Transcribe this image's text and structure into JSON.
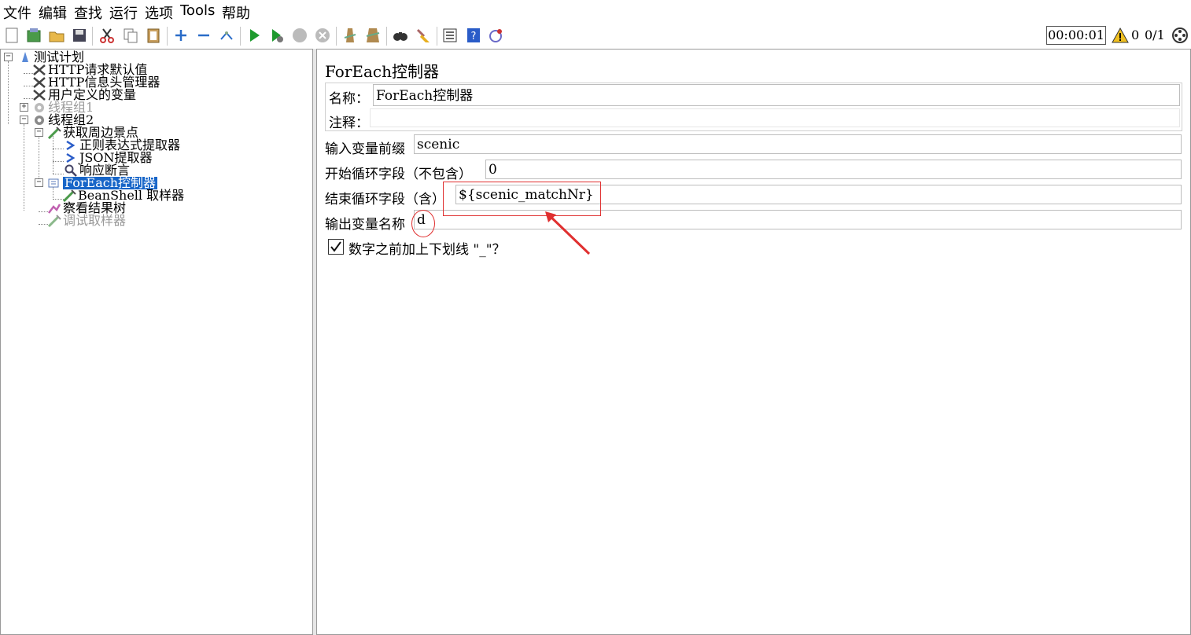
{
  "menu": [
    "文件",
    "编辑",
    "查找",
    "运行",
    "选项",
    "Tools",
    "帮助"
  ],
  "toolbar": {
    "icons": [
      "new-icon",
      "templates-icon",
      "open-icon",
      "save-icon",
      "cut-icon",
      "copy-icon",
      "paste-icon",
      "expand-icon",
      "collapse-icon",
      "toggle-icon",
      "start-icon",
      "start-no-pause-icon",
      "stop-icon",
      "shutdown-icon",
      "clear-icon",
      "clear-all-icon",
      "search-icon",
      "reset-search-icon",
      "function-helper-icon",
      "help-icon",
      "remote-icon"
    ],
    "timer": "00:00:01",
    "warnings": "0",
    "threads": "0/1"
  },
  "tree": [
    {
      "label": "测试计划",
      "icon": "test-plan-icon",
      "state": "normal"
    },
    {
      "label": "HTTP请求默认值",
      "icon": "config-wrench-icon",
      "state": "normal"
    },
    {
      "label": "HTTP信息头管理器",
      "icon": "config-wrench-icon",
      "state": "normal"
    },
    {
      "label": "用户定义的变量",
      "icon": "config-wrench-icon",
      "state": "normal"
    },
    {
      "label": "线程组1",
      "icon": "gear-icon",
      "state": "disabled"
    },
    {
      "label": "线程组2",
      "icon": "gear-icon",
      "state": "normal"
    },
    {
      "label": "获取周边景点",
      "icon": "sampler-pipette-icon",
      "state": "normal"
    },
    {
      "label": "正则表达式提取器",
      "icon": "extractor-arrow-icon",
      "state": "normal"
    },
    {
      "label": "JSON提取器",
      "icon": "extractor-arrow-icon",
      "state": "normal"
    },
    {
      "label": "响应断言",
      "icon": "magnifier-icon",
      "state": "normal"
    },
    {
      "label": "ForEach控制器",
      "icon": "foreach-controller-icon",
      "state": "selected"
    },
    {
      "label": "BeanShell 取样器",
      "icon": "sampler-pipette-icon",
      "state": "normal"
    },
    {
      "label": "察看结果树",
      "icon": "listener-icon",
      "state": "normal"
    },
    {
      "label": "调试取样器",
      "icon": "sampler-pipette-icon",
      "state": "disabled"
    }
  ],
  "panel": {
    "title": "ForEach控制器",
    "name_label": "名称：",
    "name_value": "ForEach控制器",
    "comment_label": "注释：",
    "comment_value": "",
    "prefix_label": "输入变量前缀",
    "prefix_value": "scenic",
    "start_label": "开始循环字段（不包含）",
    "start_value": "0",
    "end_label": "结束循环字段（含）",
    "end_value": "${scenic_matchNr}",
    "output_label": "输出变量名称",
    "output_value": "d",
    "checkbox_label": "数字之前加上下划线 \"_\"？",
    "checkbox_checked": true
  },
  "colors": {
    "selection": "#1765c8",
    "annotation": "#e03030"
  }
}
